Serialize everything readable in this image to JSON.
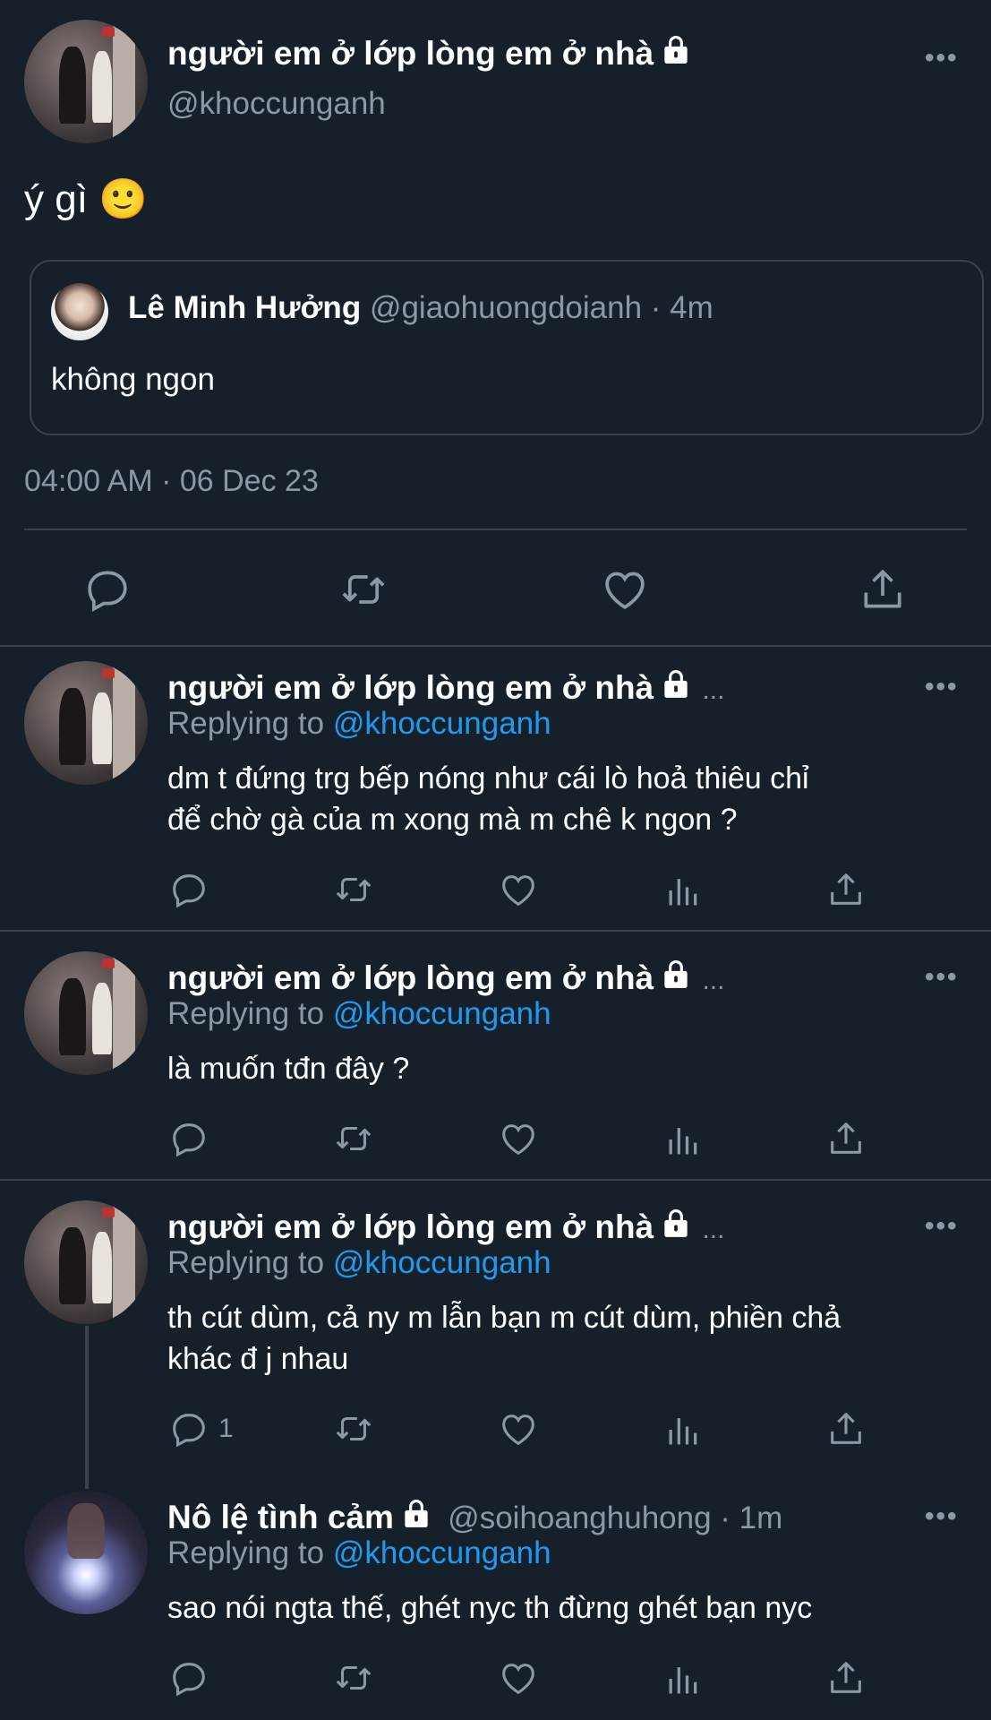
{
  "main_tweet": {
    "display_name": "người em ở lớp lòng em ở nhà",
    "handle": "@khoccunganh",
    "text": "ý gì 🙂",
    "timestamp": "04:00 AM · 06 Dec 23",
    "quote": {
      "display_name": "Lê Minh Hưởng",
      "handle_time": "@giaohuongdoianh · 4m",
      "text": "không ngon"
    }
  },
  "replies": [
    {
      "display_name": "người em ở lớp lòng em ở nhà",
      "ellipsis": "...",
      "replying_label": "Replying to",
      "replying_to": "@khoccunganh",
      "text_line1": "dm t đứng trg bếp nóng như cái lò hoả thiêu chỉ",
      "text_line2": "để chờ gà của m xong mà m chê k ngon ?"
    },
    {
      "display_name": "người em ở lớp lòng em ở nhà",
      "ellipsis": "...",
      "replying_label": "Replying to",
      "replying_to": "@khoccunganh",
      "text_line1": "là muốn tđn đây ?",
      "text_line2": ""
    },
    {
      "display_name": "người em ở lớp lòng em ở nhà",
      "ellipsis": "...",
      "replying_label": "Replying to",
      "replying_to": "@khoccunganh",
      "text_line1": "th cút dùm, cả ny m lẫn bạn m cút dùm, phiền chả",
      "text_line2": "khác đ j nhau",
      "reply_count": "1"
    },
    {
      "display_name": "Nô lệ tình cảm",
      "handle_time": "@soihoanghuhong · 1m",
      "replying_label": "Replying to",
      "replying_to": "@khoccunganh",
      "text_line1": "sao nói ngta thế, ghét nyc th đừng ghét bạn nyc",
      "text_line2": ""
    }
  ],
  "more_label": "•••",
  "icons": [
    "reply-icon",
    "retweet-icon",
    "like-icon",
    "views-icon",
    "share-icon",
    "lock-icon",
    "more-icon"
  ],
  "colors": {
    "background": "#15202b",
    "text": "#ffffff",
    "secondary": "#8b98a5",
    "link": "#1d9bf0",
    "divider": "#38444d"
  }
}
